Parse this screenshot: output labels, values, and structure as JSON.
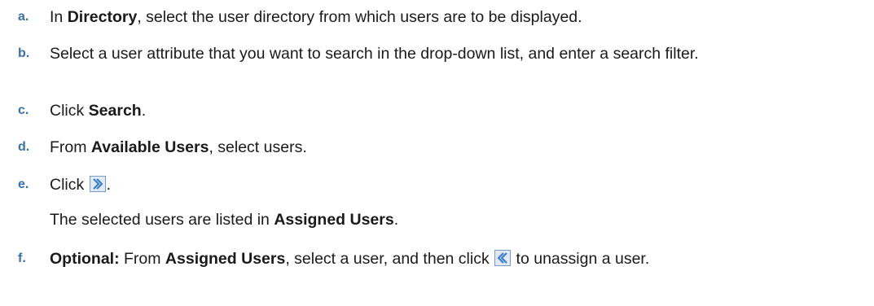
{
  "steps": [
    {
      "marker": "a.",
      "pre": "In ",
      "bold": "Directory",
      "post": ", select the user directory from which users are to be displayed."
    },
    {
      "marker": "b.",
      "text": "Select a user attribute that you want to search in the drop-down list, and enter a search filter."
    },
    {
      "marker": "c.",
      "pre": "Click ",
      "bold": "Search",
      "post": "."
    },
    {
      "marker": "d.",
      "pre": "From ",
      "bold": "Available Users",
      "post": ", select users."
    },
    {
      "marker": "e.",
      "pre": "Click ",
      "icon": "assign-arrow-right-icon",
      "post": ".",
      "note_pre": "The selected users are listed in ",
      "note_bold": "Assigned Users",
      "note_post": "."
    },
    {
      "marker": "f.",
      "bold1": "Optional:",
      "pre": " From ",
      "bold2": "Assigned Users",
      "mid": ", select a user, and then click ",
      "icon": "unassign-arrow-left-icon",
      "post": " to unassign a user."
    }
  ],
  "colors": {
    "marker": "#3a6fa7",
    "text": "#1a1a1a",
    "icon_border": "#7a9cc4",
    "icon_fill": "#dfeaf6",
    "icon_arrow": "#3b7fd0"
  }
}
